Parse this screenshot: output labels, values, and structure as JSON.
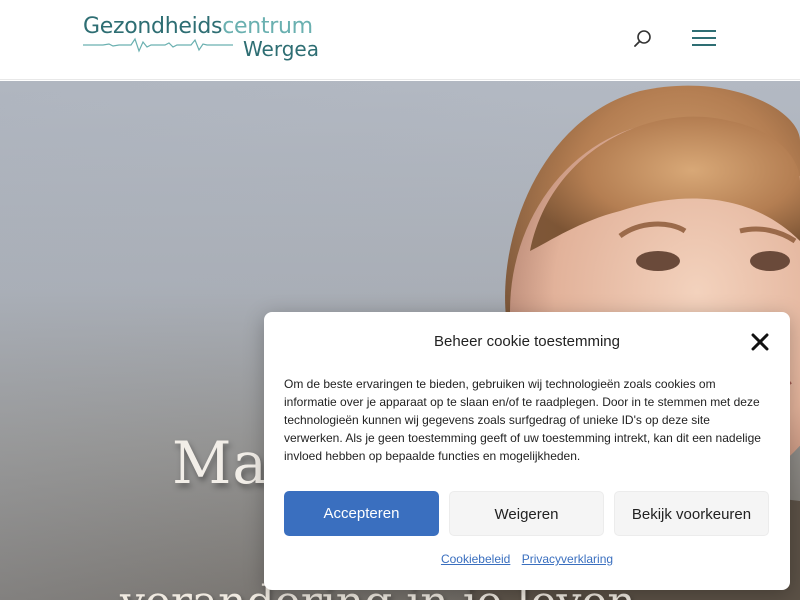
{
  "header": {
    "logo": {
      "part1": "Gezondheids",
      "part2": "centrum",
      "part3": "Wergea"
    }
  },
  "hero": {
    "title": "Maa",
    "subtitle": "verandering in je leven"
  },
  "cookie": {
    "title": "Beheer cookie toestemming",
    "body": "Om de beste ervaringen te bieden, gebruiken wij technologieën zoals cookies om informatie over je apparaat op te slaan en/of te raadplegen. Door in te stemmen met deze technologieën kunnen wij gegevens zoals surfgedrag of unieke ID's op deze site verwerken. Als je geen toestemming geeft of uw toestemming intrekt, kan dit een nadelige invloed hebben op bepaalde functies en mogelijkheden.",
    "accept_label": "Accepteren",
    "deny_label": "Weigeren",
    "prefs_label": "Bekijk voorkeuren",
    "link_cookie_policy": "Cookiebeleid",
    "link_privacy": "Privacyverklaring"
  },
  "colors": {
    "brand": "#2e6e73",
    "brand_light": "#6ab0b0",
    "accept_button": "#3a6fbf"
  }
}
